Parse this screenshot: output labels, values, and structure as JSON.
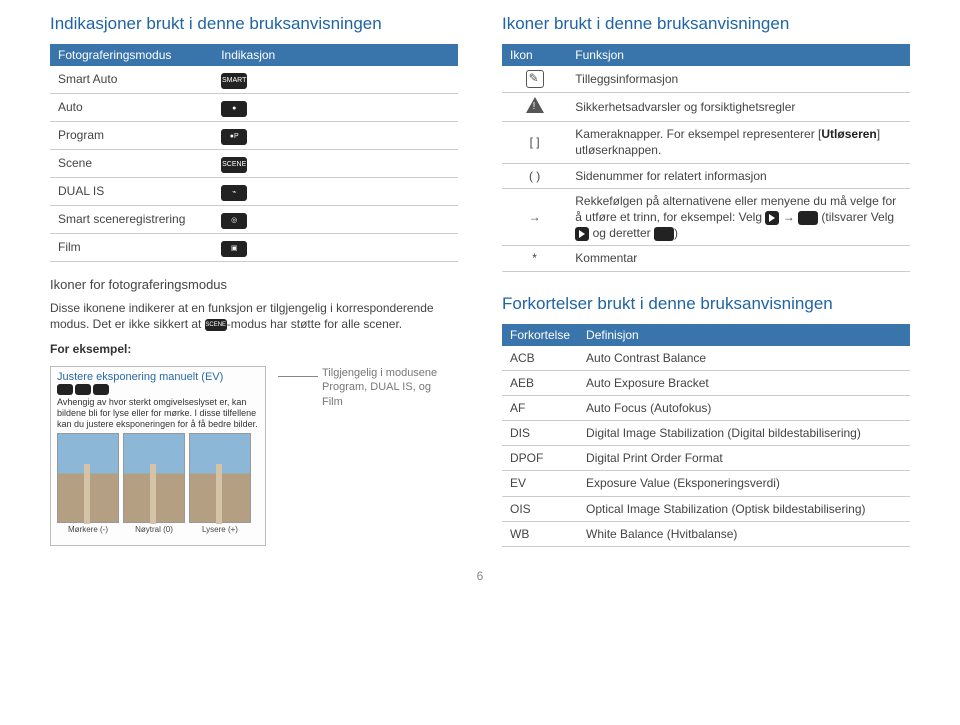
{
  "page_number": "6",
  "left": {
    "h_indications": "Indikasjoner brukt i denne bruksanvisningen",
    "th_mode": "Fotograferingsmodus",
    "th_ind": "Indikasjon",
    "modes": [
      {
        "label": "Smart Auto",
        "icon": "SMART"
      },
      {
        "label": "Auto",
        "icon": "●"
      },
      {
        "label": "Program",
        "icon": "●P"
      },
      {
        "label": "Scene",
        "icon": "SCENE"
      },
      {
        "label": "DUAL IS",
        "icon": "⌁"
      },
      {
        "label": "Smart sceneregistrering",
        "icon": "◎"
      },
      {
        "label": "Film",
        "icon": "▣"
      }
    ],
    "h_modeicons": "Ikoner for fotograferingsmodus",
    "para1a": "Disse ikonene indikerer at en funksjon er tilgjengelig i korresponderende modus. Det er ikke sikkert at ",
    "para1b": "-modus har støtte for alle scener.",
    "scene_chip": "SCENE",
    "for_eksempel": "For eksempel:",
    "example": {
      "title": "Justere eksponering manuelt (EV)",
      "body": "Avhengig av hvor sterkt omgivelseslyset er, kan bildene bli for lyse eller for mørke. I disse tilfellene kan du justere eksponeringen for å få bedre bilder.",
      "labels": [
        "Mørkere (-)",
        "Nøytral (0)",
        "Lysere (+)"
      ]
    },
    "example_note": "Tilgjengelig i modusene Program, DUAL IS, og Film"
  },
  "right": {
    "h_icons": "Ikoner brukt i denne bruksanvisningen",
    "th_icon": "Ikon",
    "th_func": "Funksjon",
    "rows": [
      {
        "sym": "note",
        "text": "Tilleggsinformasjon"
      },
      {
        "sym": "warn",
        "text": "Sikkerhetsadvarsler og forsiktighetsregler"
      },
      {
        "sym": "[ ]",
        "text_a": "Kameraknapper. For eksempel representerer [",
        "bold": "Utløseren",
        "text_b": "] utløserknappen."
      },
      {
        "sym": "( )",
        "text": "Sidenummer for relatert informasjon"
      },
      {
        "sym": "→",
        "text_arrow": "Rekkefølgen på alternativene eller menyene du må velge for å utføre et trinn, for eksempel: Velg ",
        "mid": " → ",
        "tail": " (tilsvarer Velg ",
        "tail2": " og deretter ",
        "tail3": ")"
      },
      {
        "sym": "*",
        "text": "Kommentar"
      }
    ],
    "h_abbrev": "Forkortelser brukt i denne bruksanvisningen",
    "th_abbr": "Forkortelse",
    "th_def": "Definisjon",
    "abbrev": [
      {
        "k": "ACB",
        "v": "Auto Contrast Balance"
      },
      {
        "k": "AEB",
        "v": "Auto Exposure Bracket"
      },
      {
        "k": "AF",
        "v": "Auto Focus (Autofokus)"
      },
      {
        "k": "DIS",
        "v": "Digital Image Stabilization (Digital bildestabilisering)"
      },
      {
        "k": "DPOF",
        "v": "Digital Print Order Format"
      },
      {
        "k": "EV",
        "v": "Exposure Value (Eksponeringsverdi)"
      },
      {
        "k": "OIS",
        "v": "Optical Image Stabilization (Optisk bildestabilisering)"
      },
      {
        "k": "WB",
        "v": "White Balance (Hvitbalanse)"
      }
    ]
  }
}
